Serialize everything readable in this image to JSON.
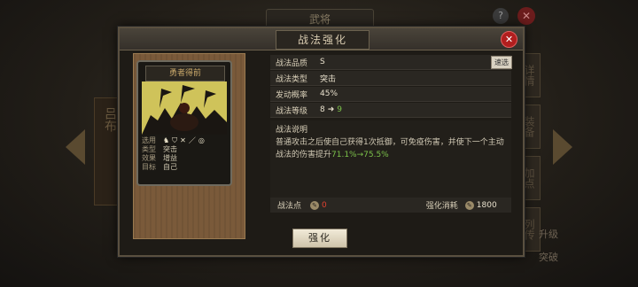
{
  "background": {
    "title": "武将",
    "help": "?",
    "close": "✕",
    "side_banner": "吕布",
    "side_tabs": [
      "详情",
      "装备",
      "加点",
      "列传"
    ],
    "side_buttons": [
      "升级",
      "突破"
    ]
  },
  "dialog": {
    "title": "战法强化",
    "close": "✕",
    "card": {
      "name": "勇者得前",
      "info": {
        "target_label": "选用",
        "type_label": "类型",
        "type_value": "突击",
        "effect_label": "效果",
        "effect_value": "增益",
        "goal_label": "目标",
        "goal_value": "自己"
      }
    },
    "attributes": {
      "quality_label": "战法品质",
      "quality_value": "S",
      "swap_button": "速选",
      "type_label": "战法类型",
      "type_value": "突击",
      "rate_label": "发动概率",
      "rate_value": "45%",
      "level_label": "战法等级",
      "level_current": "8",
      "level_next": "9"
    },
    "description": {
      "heading": "战法说明",
      "text_before": "普通攻击之后使自己获得1次抵御，可免疫伤害，并使下一个主动战法的伤害提升",
      "highlight": "71.1%→75.5%"
    },
    "costs": {
      "points_label": "战法点",
      "points_value": "0",
      "consume_label": "强化消耗",
      "consume_value": "1800"
    },
    "upgrade_button": "强化"
  },
  "colors": {
    "accent_green": "#7cc24a",
    "close_red": "#b21e1e",
    "cost_red": "#e04030"
  }
}
